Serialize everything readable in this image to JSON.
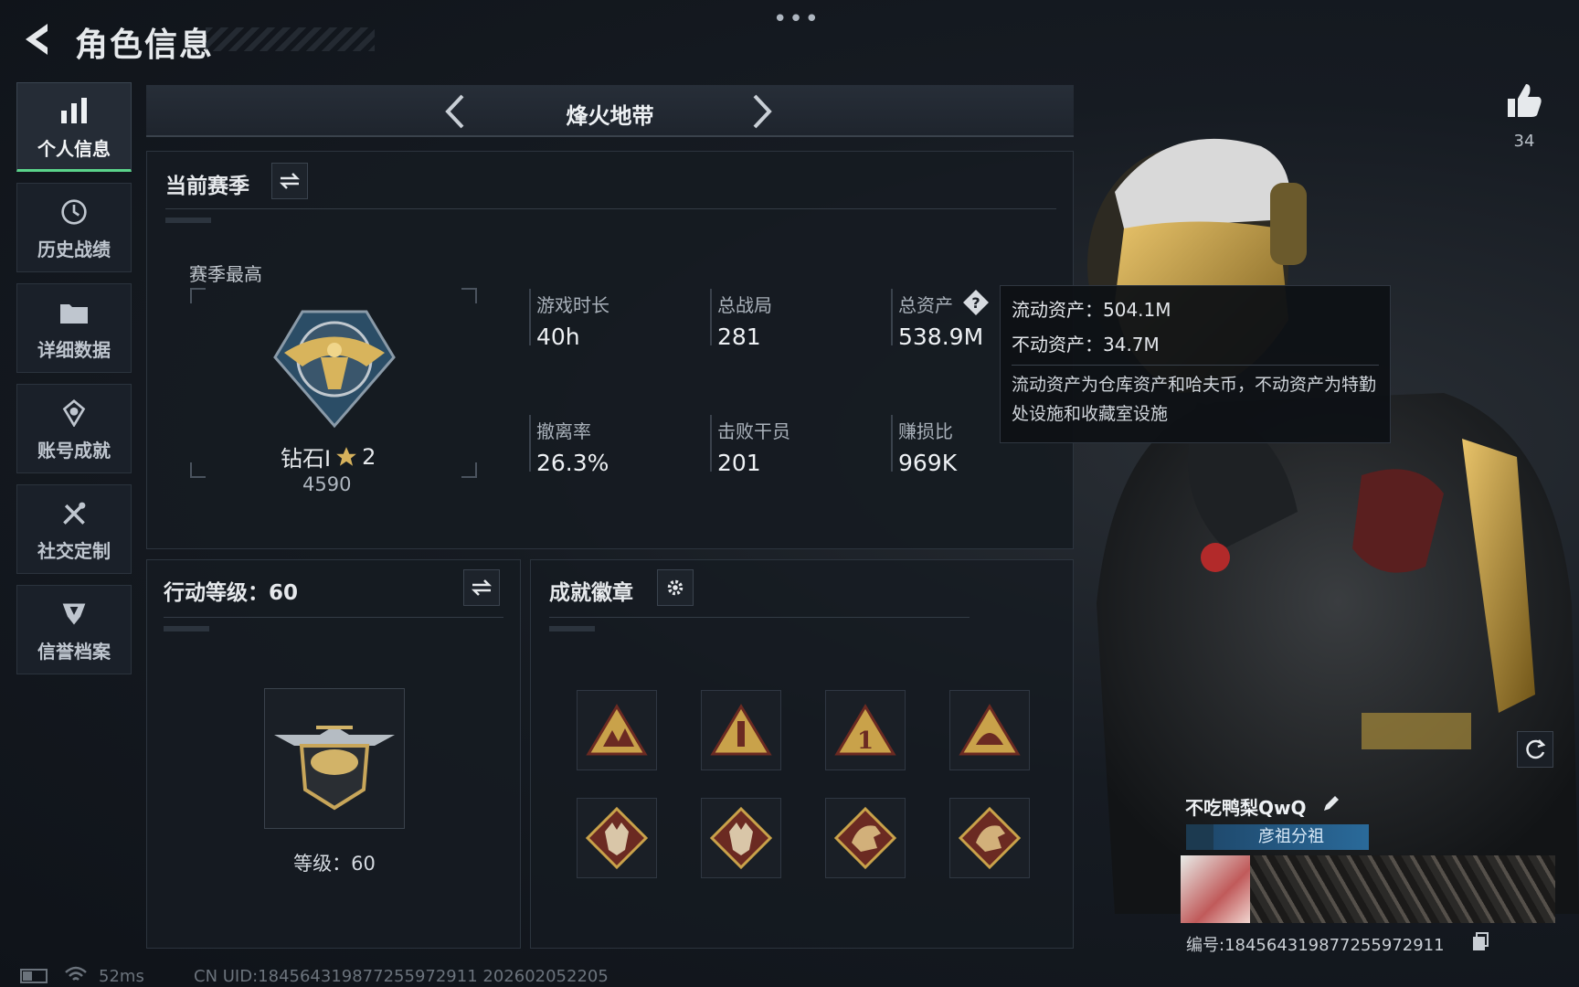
{
  "header": {
    "title": "角色信息",
    "more": "•••"
  },
  "sidebar": {
    "items": [
      {
        "label": "个人信息",
        "icon": "bar-chart-icon",
        "active": true
      },
      {
        "label": "历史战绩",
        "icon": "clock-icon"
      },
      {
        "label": "详细数据",
        "icon": "folder-icon"
      },
      {
        "label": "账号成就",
        "icon": "medal-icon"
      },
      {
        "label": "社交定制",
        "icon": "tools-icon"
      },
      {
        "label": "信誉档案",
        "icon": "shield-icon"
      }
    ]
  },
  "mode": {
    "title": "烽火地带"
  },
  "season": {
    "header": "当前赛季",
    "best_label": "赛季最高",
    "rank_name": "钻石I",
    "rank_stars": "2",
    "rank_points": "4590",
    "stats": [
      {
        "label": "游戏时长",
        "value": "40h"
      },
      {
        "label": "总战局",
        "value": "281"
      },
      {
        "label": "总资产",
        "value": "538.9M"
      },
      {
        "label": "撤离率",
        "value": "26.3%"
      },
      {
        "label": "击败干员",
        "value": "201"
      },
      {
        "label": "赚损比",
        "value": "969K"
      }
    ]
  },
  "tooltip": {
    "liquid": "流动资产：504.1M",
    "fixed": "不动资产：34.7M",
    "note": "流动资产为仓库资产和哈夫币，不动资产为特勤处设施和收藏室设施"
  },
  "action_level": {
    "header": "行动等级：60",
    "level_text": "等级：60"
  },
  "achievements": {
    "header": "成就徽章",
    "badges": [
      "soldiers-badge-icon",
      "rocket-badge-icon",
      "number-one-badge-icon",
      "helmet-badge-icon",
      "wolf-badge-icon",
      "wolf-badge-icon",
      "dragon-badge-icon",
      "dragon-badge-icon"
    ]
  },
  "likes": {
    "count": "34"
  },
  "player": {
    "name": "不吃鸭梨QwQ",
    "title": "彦祖分祖",
    "uid": "编号:18456431987725597291​1"
  },
  "footer": {
    "ping": "52ms",
    "uid_line": "CN UID:184564319877255972911 202602052205"
  },
  "colors": {
    "accent_green": "#5ad38a",
    "gold": "#c9a24a",
    "badge_red": "#6b2a22"
  }
}
